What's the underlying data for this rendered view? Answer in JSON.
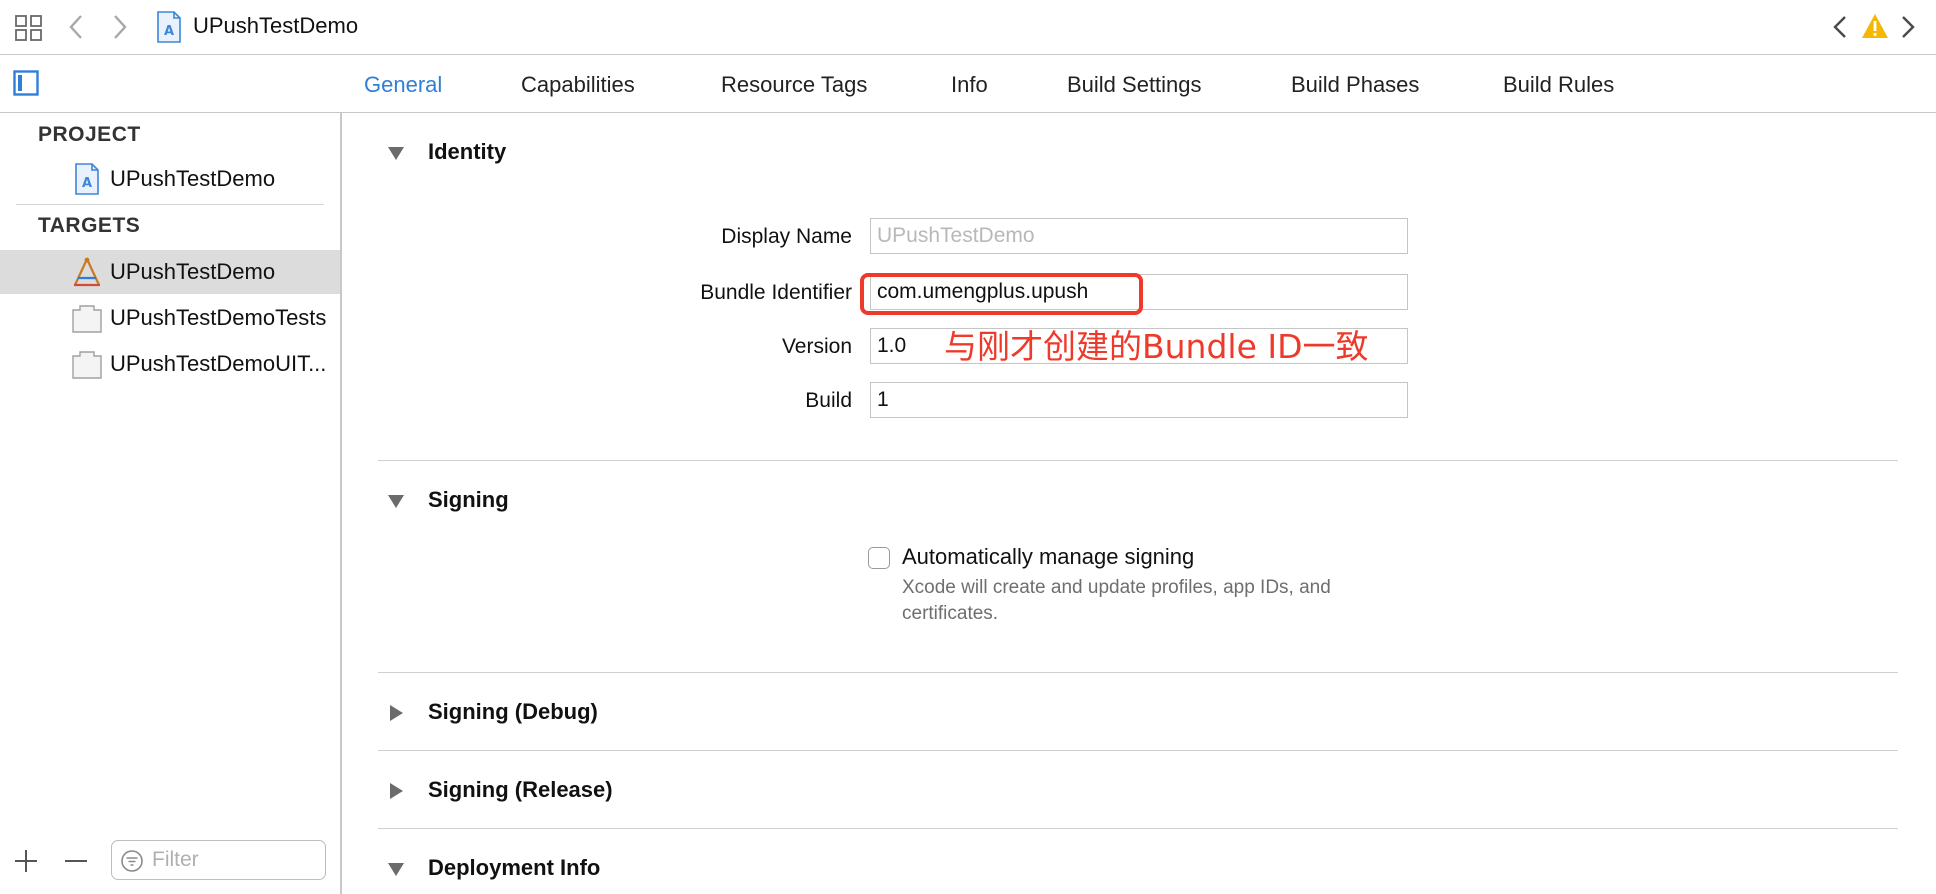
{
  "topbar": {
    "project_title": "UPushTestDemo",
    "icons": [
      "grid-icon",
      "chevron-left-icon",
      "chevron-right-icon",
      "xcode-project-icon",
      "warning-icon"
    ]
  },
  "tabs": [
    {
      "label": "General",
      "active": true
    },
    {
      "label": "Capabilities",
      "active": false
    },
    {
      "label": "Resource Tags",
      "active": false
    },
    {
      "label": "Info",
      "active": false
    },
    {
      "label": "Build Settings",
      "active": false
    },
    {
      "label": "Build Phases",
      "active": false
    },
    {
      "label": "Build Rules",
      "active": false
    }
  ],
  "sidebar": {
    "project_header": "PROJECT",
    "project_item": "UPushTestDemo",
    "targets_header": "TARGETS",
    "targets": [
      {
        "label": "UPushTestDemo",
        "selected": true
      },
      {
        "label": "UPushTestDemoTests",
        "selected": false
      },
      {
        "label": "UPushTestDemoUIT...",
        "selected": false
      }
    ],
    "filter_placeholder": "Filter"
  },
  "identity": {
    "title": "Identity",
    "display_name_label": "Display Name",
    "display_name_placeholder": "UPushTestDemo",
    "bundle_id_label": "Bundle Identifier",
    "bundle_id_value": "com.umengplus.upush",
    "version_label": "Version",
    "version_value": "1.0",
    "build_label": "Build",
    "build_value": "1",
    "annotation": "与刚才创建的Bundle ID一致"
  },
  "signing": {
    "title": "Signing",
    "auto_manage_label": "Automatically manage signing",
    "auto_manage_checked": false,
    "help_text": "Xcode will create and update profiles, app IDs, and certificates."
  },
  "sections": {
    "signing_debug": "Signing (Debug)",
    "signing_release": "Signing (Release)",
    "deployment_info": "Deployment Info"
  },
  "colors": {
    "accent": "#2f7fd6",
    "annotation": "#ee3a2a",
    "warning": "#f5b800",
    "selected_row": "#dcdcdc"
  }
}
